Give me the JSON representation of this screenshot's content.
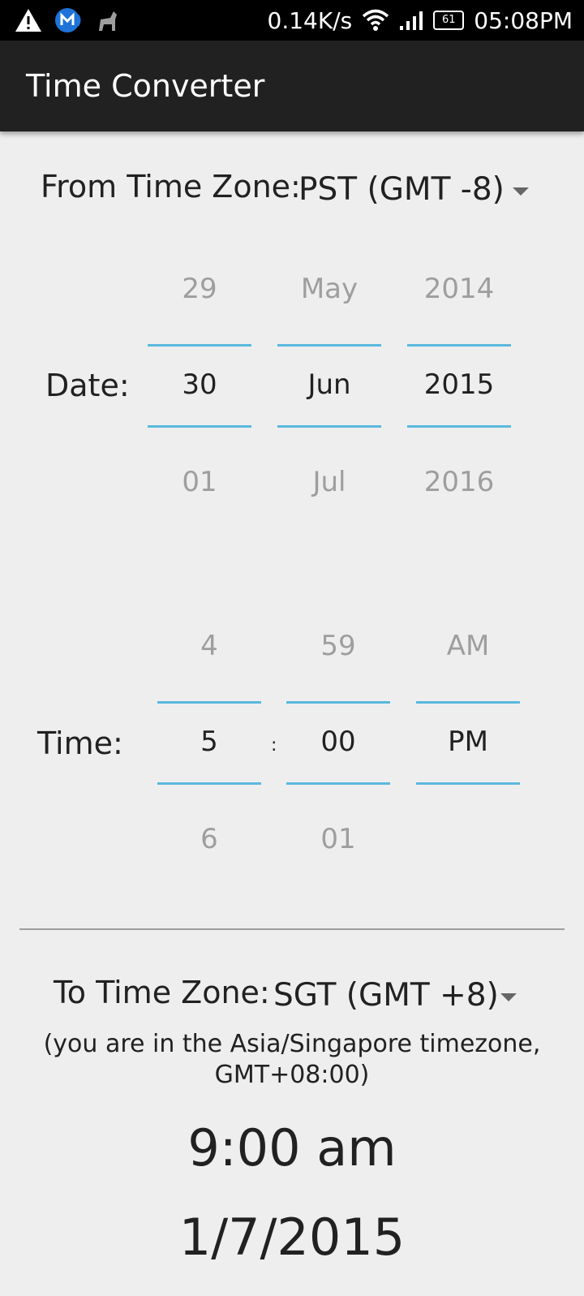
{
  "status_bar": {
    "speed": "0.14K/s",
    "battery": "61",
    "clock": "05:08PM",
    "icons": [
      "warning-icon",
      "malwarebytes-icon",
      "cat-icon",
      "wifi-icon",
      "signal-icon",
      "battery-icon"
    ]
  },
  "app_bar": {
    "title": "Time Converter"
  },
  "from_zone": {
    "label": "From Time Zone:",
    "value": "PST (GMT -8)"
  },
  "date": {
    "label": "Date:",
    "day": {
      "prev": "29",
      "current": "30",
      "next": "01"
    },
    "month": {
      "prev": "May",
      "current": "Jun",
      "next": "Jul"
    },
    "year": {
      "prev": "2014",
      "current": "2015",
      "next": "2016"
    }
  },
  "time": {
    "label": "Time:",
    "separator": ":",
    "hour": {
      "prev": "4",
      "current": "5",
      "next": "6"
    },
    "minute": {
      "prev": "59",
      "current": "00",
      "next": "01"
    },
    "ampm": {
      "prev": "AM",
      "current": "PM",
      "next": ""
    }
  },
  "to_zone": {
    "label": "To Time Zone:",
    "value": "SGT (GMT +8)",
    "note_line1": "(you are in the Asia/Singapore timezone,",
    "note_line2": "GMT+08:00)"
  },
  "result": {
    "time": "9:00 am",
    "date": "1/7/2015"
  },
  "colors": {
    "accent_line": "#5ab9de",
    "app_bar": "#212121",
    "background": "#eeeeee"
  }
}
